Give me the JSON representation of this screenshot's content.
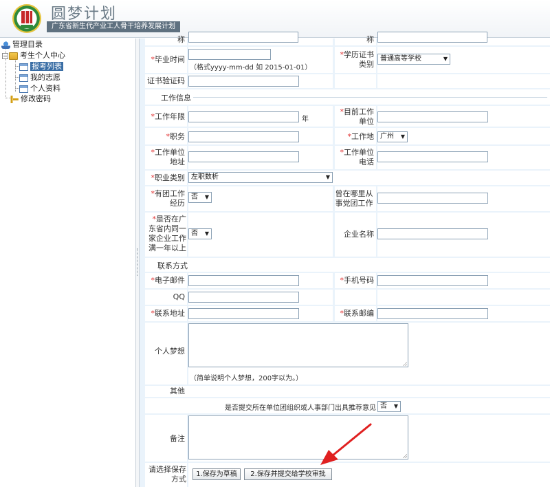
{
  "header": {
    "title": "圆梦计划",
    "subtitle": "广东省新生代产业工人骨干培养发展计划"
  },
  "sidebar": {
    "root": "管理目录",
    "group": "考生个人中心",
    "items": [
      {
        "label": "报考列表",
        "selected": true
      },
      {
        "label": "我的志愿",
        "selected": false
      },
      {
        "label": "个人资料",
        "selected": false
      }
    ],
    "change_password": "修改密码"
  },
  "form": {
    "top_left_label_fragment": "称",
    "top_right_label_fragment": "称",
    "graduation_time": {
      "label": "毕业时间",
      "value": "",
      "hint": "（格式yyyy-mm-dd 如 2015-01-01）"
    },
    "degree_type": {
      "label": "学历证书类别",
      "value": "普通高等学校"
    },
    "cert_number": {
      "label": "证书验证码",
      "value": ""
    },
    "section_work": "工作信息",
    "work_years": {
      "label": "工作年限",
      "value": "",
      "unit": "年"
    },
    "current_unit": {
      "label": "目前工作单位",
      "value": ""
    },
    "position": {
      "label": "职务",
      "value": ""
    },
    "work_place": {
      "label": "工作地",
      "value": "广州"
    },
    "unit_address": {
      "label": "工作单位地址",
      "value": ""
    },
    "unit_phone": {
      "label": "工作单位电话",
      "value": ""
    },
    "job_category": {
      "label": "职业类别",
      "value": "左职数析"
    },
    "youth_experience": {
      "label": "有团工作经历",
      "value": "否"
    },
    "youth_work_org": {
      "label": "曾在哪里从事党团工作",
      "value": ""
    },
    "gd_one_year": {
      "label": "是否在广东省内同一家企业工作满一年以上",
      "value": "否"
    },
    "company_name": {
      "label": "企业名称",
      "value": ""
    },
    "section_contact": "联系方式",
    "email": {
      "label": "电子邮件",
      "value": ""
    },
    "mobile": {
      "label": "手机号码",
      "value": ""
    },
    "qq": {
      "label": "QQ",
      "value": ""
    },
    "address": {
      "label": "联系地址",
      "value": ""
    },
    "postcode": {
      "label": "联系邮编",
      "value": ""
    },
    "dream": {
      "label": "个人梦想",
      "value": "",
      "hint": "（简单说明个人梦想，200字以为。）"
    },
    "other_label": "其他",
    "submit_org_question": {
      "label": "是否提交所在单位团组织或人事部门出具推荐意见",
      "value": "否"
    },
    "remarks": {
      "label": "备注",
      "value": ""
    },
    "save_method_label": "请选择保存方式",
    "btn_draft": "1.保存为草稿",
    "btn_submit": "2.保存并提交给学校审批"
  },
  "colors": {
    "accent": "#3a6ea5",
    "required": "#e03030",
    "annotation_arrow": "#e02020"
  }
}
